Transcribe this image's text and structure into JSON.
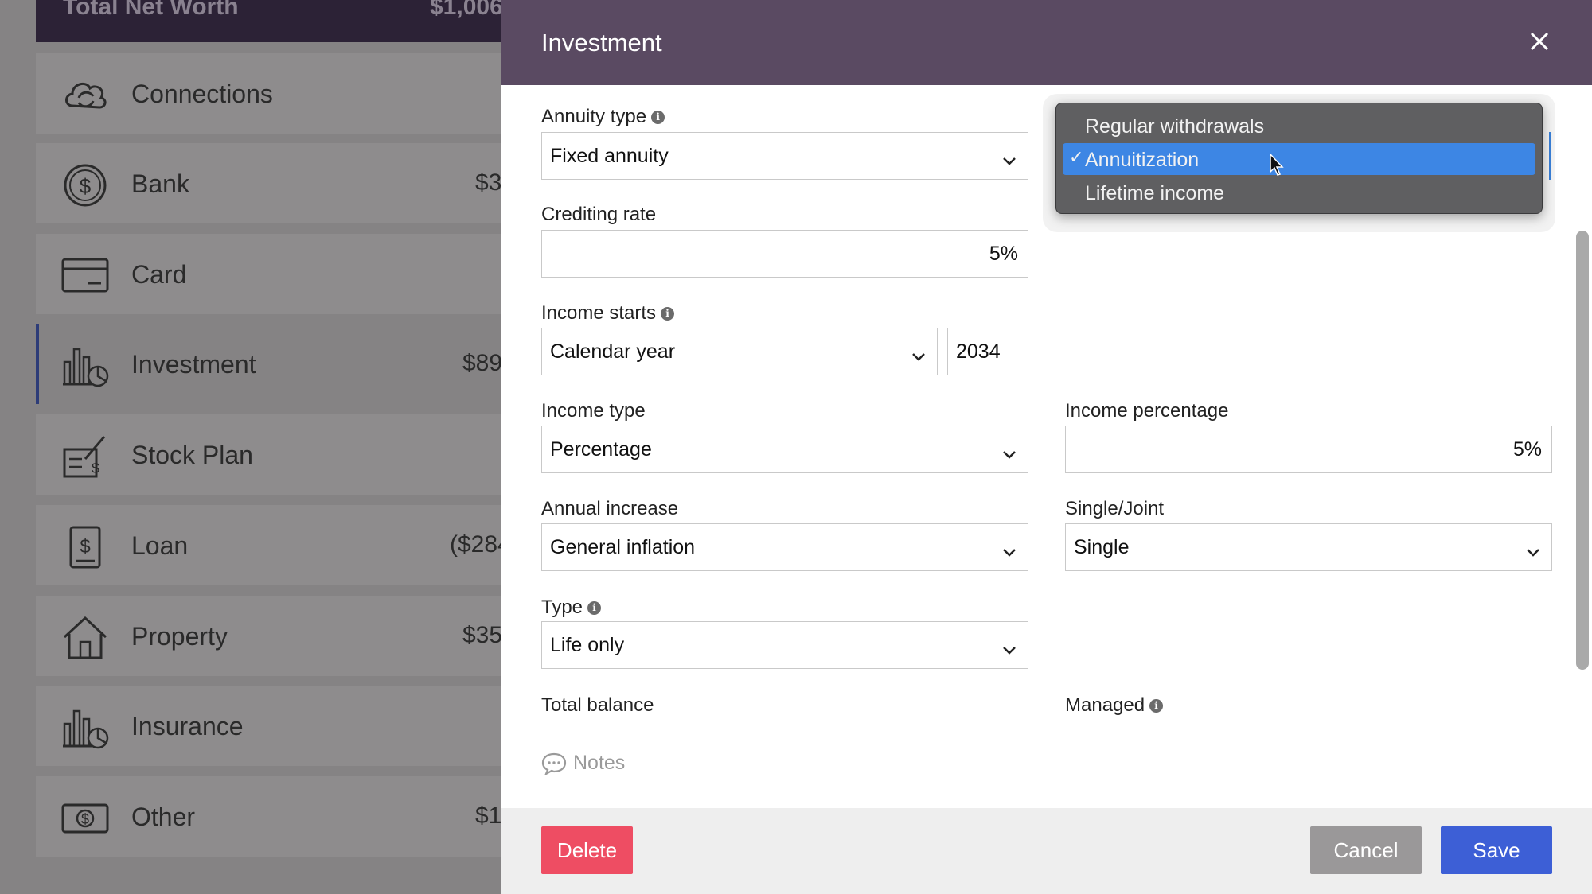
{
  "sidebar": {
    "net_worth_label": "Total Net Worth",
    "net_worth_value": "$1,006",
    "items": [
      {
        "label": "Connections",
        "amount": "",
        "icon": "cloud-sync-icon"
      },
      {
        "label": "Bank",
        "amount": "$3",
        "icon": "dollar-coin-icon"
      },
      {
        "label": "Card",
        "amount": "",
        "icon": "credit-card-icon"
      },
      {
        "label": "Investment",
        "amount": "$89",
        "icon": "bar-chart-pie-icon",
        "active": true
      },
      {
        "label": "Stock Plan",
        "amount": "",
        "icon": "stock-certificate-icon"
      },
      {
        "label": "Loan",
        "amount": "($284",
        "icon": "loan-document-icon"
      },
      {
        "label": "Property",
        "amount": "$35",
        "icon": "house-icon"
      },
      {
        "label": "Insurance",
        "amount": "",
        "icon": "bar-chart-pie-icon"
      },
      {
        "label": "Other",
        "amount": "$1",
        "icon": "banknote-icon"
      }
    ]
  },
  "modal": {
    "title": "Investment",
    "fields": {
      "annuity_type": {
        "label": "Annuity type",
        "value": "Fixed annuity"
      },
      "crediting_rate": {
        "label": "Crediting rate",
        "value": "5%"
      },
      "income_starts": {
        "label": "Income starts",
        "value": "Calendar year",
        "year": "2034"
      },
      "income_type": {
        "label": "Income type",
        "value": "Percentage"
      },
      "income_percentage": {
        "label": "Income percentage",
        "value": "5%"
      },
      "annual_increase": {
        "label": "Annual increase",
        "value": "General inflation"
      },
      "single_joint": {
        "label": "Single/Joint",
        "value": "Single"
      },
      "type": {
        "label": "Type",
        "value": "Life only"
      },
      "total_balance": {
        "label": "Total balance"
      },
      "managed": {
        "label": "Managed"
      }
    },
    "notes_label": "Notes",
    "buttons": {
      "delete": "Delete",
      "cancel": "Cancel",
      "save": "Save"
    }
  },
  "dropdown": {
    "options": [
      "Regular withdrawals",
      "Annuitization",
      "Lifetime income"
    ],
    "selected": "Annuitization",
    "check_mark": "✓"
  },
  "colors": {
    "header": "#5a4a62",
    "delete": "#ee4d63",
    "save": "#3d5fd6",
    "cancel": "#9a9899",
    "selection": "#3d86e4"
  }
}
